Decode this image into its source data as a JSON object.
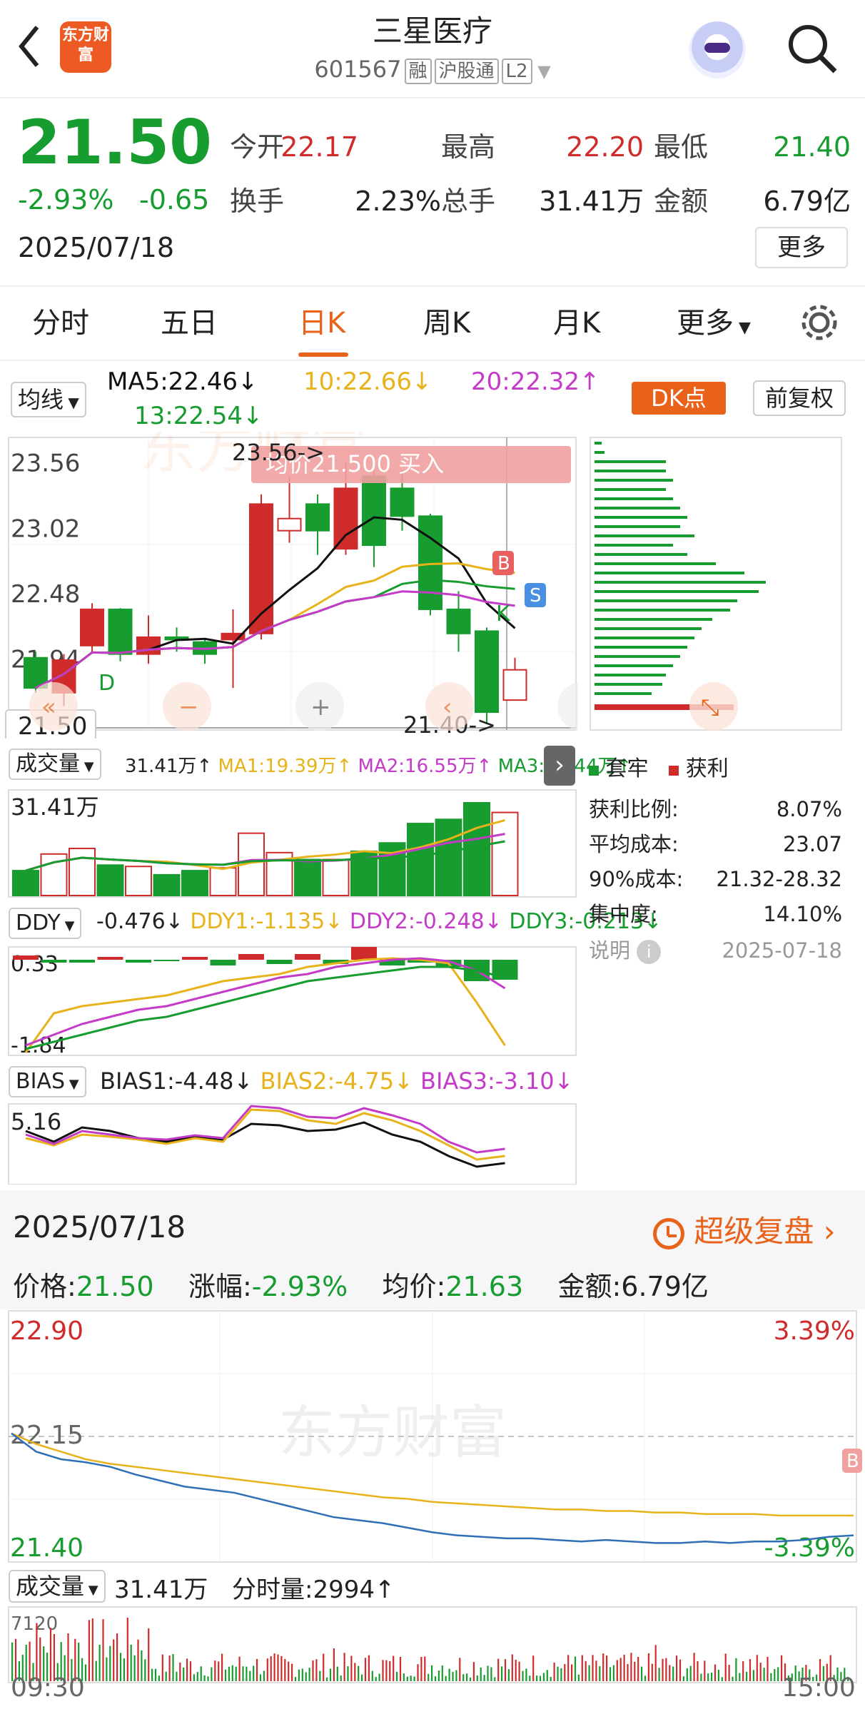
{
  "header": {
    "title": "三星医疗",
    "code": "601567",
    "tags": [
      "融",
      "沪股通",
      "L2"
    ],
    "logo_text": "东方财富"
  },
  "quote": {
    "price": "21.50",
    "pct": "-2.93%",
    "change": "-0.65",
    "date": "2025/07/18",
    "open_label": "今开",
    "open": "22.17",
    "high_label": "最高",
    "high": "22.20",
    "low_label": "最低",
    "low": "21.40",
    "turnover_label": "换手",
    "turnover": "2.23%",
    "volume_label": "总手",
    "volume": "31.41万",
    "amount_label": "金额",
    "amount": "6.79亿",
    "more_label": "更多"
  },
  "tabs": [
    "分时",
    "五日",
    "日K",
    "周K",
    "月K",
    "更多"
  ],
  "ma_bar": {
    "selector": "均线",
    "ma5": "MA5:22.46↓",
    "ma10": "10:22.66↓",
    "ma20": "20:22.32↑",
    "ma13": "13:22.54↓",
    "dk": "DK点",
    "fq": "前复权"
  },
  "kchart": {
    "ylabels": [
      "23.56",
      "23.02",
      "22.48",
      "21.94"
    ],
    "last_price": "21.50",
    "hi_note": "23.56->",
    "lo_note": "21.40->",
    "banner": "均价21.500  买入",
    "marker_B": "B",
    "marker_S": "S",
    "marker_K": "K",
    "marker_D": "D"
  },
  "colors": {
    "up": "#d02b2b",
    "down": "#179c2f",
    "ma5": "#111111",
    "ma10": "#e7b21a",
    "ma20": "#c33bc7",
    "ma13": "#179c2f",
    "accent": "#e8621a"
  },
  "chart_data": [
    {
      "type": "candlestick",
      "title": "日K",
      "candles": [
        [
          21.95,
          21.7,
          22.0,
          21.66
        ],
        [
          21.66,
          21.93,
          21.98,
          21.55
        ],
        [
          22.05,
          22.35,
          22.4,
          22.0
        ],
        [
          22.35,
          21.98,
          22.36,
          21.92
        ],
        [
          21.98,
          22.12,
          22.3,
          21.9
        ],
        [
          22.12,
          22.1,
          22.2,
          22.0
        ],
        [
          22.08,
          21.98,
          22.1,
          21.9
        ],
        [
          22.1,
          22.15,
          22.35,
          21.7
        ],
        [
          22.15,
          23.22,
          23.3,
          22.1
        ],
        [
          23.0,
          23.1,
          23.45,
          22.9
        ],
        [
          23.22,
          23.0,
          23.3,
          22.8
        ],
        [
          22.85,
          23.35,
          23.56,
          22.8
        ],
        [
          23.45,
          22.88,
          23.5,
          22.7
        ],
        [
          23.35,
          23.12,
          23.5,
          23.0
        ],
        [
          23.12,
          22.35,
          23.14,
          22.3
        ],
        [
          22.35,
          22.15,
          22.5,
          22.0
        ],
        [
          22.17,
          21.5,
          22.2,
          21.4
        ],
        [
          21.6,
          21.85,
          21.95,
          21.6
        ]
      ],
      "ylim": [
        21.4,
        23.7
      ]
    },
    {
      "type": "bar",
      "title": "成交量",
      "values": [
        18,
        30,
        34,
        22,
        21,
        15,
        18,
        20,
        45,
        31,
        26,
        26,
        32,
        38,
        52,
        55,
        67,
        60
      ],
      "ma1": "MA1:19.39万",
      "ma2": "MA2:16.55万",
      "ma3": "MA3:13.44万",
      "total": "31.41万",
      "ylabel": "31.41万",
      "selector": "成交量"
    },
    {
      "type": "line",
      "title": "DDY",
      "selector": "DDY",
      "values": "-0.476↓",
      "ddy1": "DDY1:-1.135↓",
      "ddy2": "DDY2:-0.248↓",
      "ddy3": "DDY3:-0.213↓",
      "ytop": "0.33",
      "ybot": "-1.84"
    },
    {
      "type": "line",
      "title": "BIAS",
      "selector": "BIAS",
      "bias1": "BIAS1:-4.48↓",
      "bias2": "BIAS2:-4.75↓",
      "bias3": "BIAS3:-3.10↓",
      "ytop": "5.16"
    },
    {
      "type": "line",
      "title": "分时",
      "xlabels": [
        "09:30",
        "15:00"
      ],
      "ylim": [
        21.4,
        22.9
      ],
      "pre_close": "22.15",
      "ymax": "22.90",
      "ymin": "21.40",
      "pct_top": "3.39%",
      "pct_bot": "-3.39%"
    }
  ],
  "chips": {
    "legend_trap": "套牢",
    "legend_profit": "获利",
    "rows": [
      {
        "label": "获利比例:",
        "value": "8.07%"
      },
      {
        "label": "平均成本:",
        "value": "23.07"
      },
      {
        "label": "90%成本:",
        "value": "21.32-28.32"
      },
      {
        "label": "集中度:",
        "value": "14.10%"
      }
    ],
    "note": "说明",
    "note_date": "2025-07-18"
  },
  "detail": {
    "date": "2025/07/18",
    "replay": "超级复盘",
    "price": "价格:",
    "price_val": "21.50",
    "pct": "涨幅:",
    "pct_val": "-2.93%",
    "avg": "均价:",
    "avg_val": "21.63",
    "amt": "金额:",
    "amt_val": "6.79亿"
  },
  "intraday": {
    "vol_selector": "成交量",
    "vol_total": "31.41万",
    "fsl": "分时量:2994↑",
    "vol_top": "7120"
  }
}
